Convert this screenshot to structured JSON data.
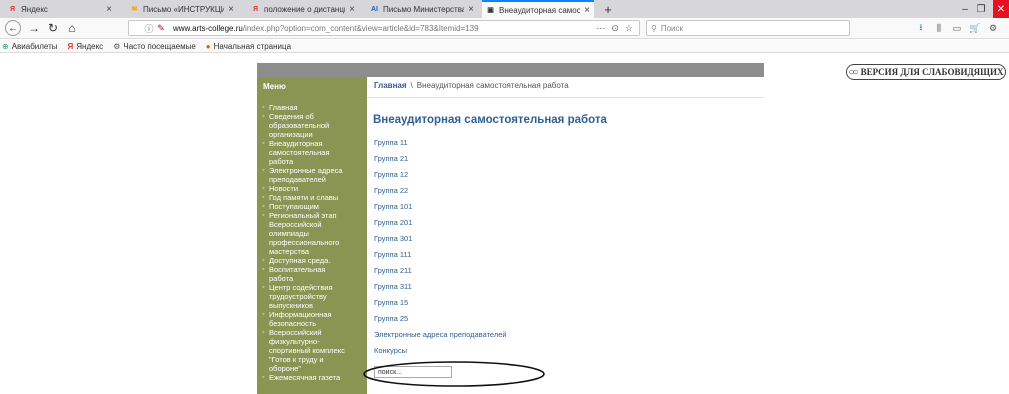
{
  "browser": {
    "tabs": [
      {
        "label": "Яндекс",
        "favicon": "Я",
        "favicon_color": "#d33",
        "active": false
      },
      {
        "label": "Письмо «ИНСТРУКЦИЯ ПО С",
        "favicon": "✉",
        "favicon_color": "#e8a300",
        "active": false
      },
      {
        "label": "положение о дистанционно",
        "favicon": "Я",
        "favicon_color": "#d33",
        "active": false
      },
      {
        "label": "Письмо Министерства прос",
        "favicon": "AI",
        "favicon_color": "#2a5db0",
        "active": false
      },
      {
        "label": "Внеаудиторная самостояте",
        "favicon": "▣",
        "favicon_color": "#333",
        "active": true
      }
    ],
    "new_tab": "+",
    "window_controls": {
      "minimize": "–",
      "restore": "❐",
      "close": "✕"
    },
    "nav": {
      "back": "←",
      "forward": "→",
      "reload": "↻",
      "home": "⌂"
    },
    "url": {
      "domain": "www.arts-college.ru",
      "path": "/index.php?option=com_content&view=article&id=783&Itemid=139"
    },
    "url_actions": {
      "more": "···",
      "pocket": "⊙",
      "bookmark": "☆"
    },
    "search": {
      "placeholder": "Поиск"
    },
    "toolbar_icons": [
      "⭳",
      "⫼",
      "▭",
      "🛒",
      "⚙"
    ]
  },
  "bookmarks": [
    {
      "label": "Авиабилеты",
      "icon": "⊕"
    },
    {
      "label": "Яндекс",
      "icon": "Я"
    },
    {
      "label": "Часто посещаемые",
      "icon": "⚙"
    },
    {
      "label": "Начальная страница",
      "icon": "●"
    }
  ],
  "site": {
    "impaired_version": "ВЕРСИЯ ДЛЯ СЛАБОВИДЯЩИХ",
    "sidebar": {
      "title": "Меню",
      "items": [
        "Главная",
        "Сведения об",
        "образовательной",
        "организации",
        "Внеаудиторная",
        "самостоятельная",
        "работа",
        "Электронные адреса",
        "преподавателей",
        "Новости",
        "Год памяти и славы",
        "Поступающим",
        "Региональный этап",
        "Всероссийской",
        "олимпиады",
        "профессионального",
        "мастерства",
        "Доступная среда.",
        "Воспитательная",
        "работа",
        "Центр содействия",
        "трудоустройству",
        "выпускников",
        "Информационная",
        "безопасность",
        "Всероссийский",
        "физкультурно-",
        "спортивный комплекс",
        "\"Готов к труду и",
        "обороне\"",
        "Ежемесячная газета"
      ],
      "bullet_rows": [
        0,
        1,
        4,
        7,
        9,
        10,
        11,
        12,
        17,
        18,
        20,
        23,
        25,
        30
      ]
    },
    "breadcrumb": {
      "home": "Главная",
      "separator": "\\",
      "current": "Внеаудиторная самостоятельная работа"
    },
    "title": "Внеаудиторная самостоятельная работа",
    "links": [
      "Группа 11",
      "Группа 21",
      "Группа 12",
      "Группа 22",
      "Группа 101",
      "Группа 201",
      "Группа 301",
      "Группа 111",
      "Группа 211",
      "Группа 311",
      "Группа 15",
      "Группа 25",
      "Электронные адреса преподавателей",
      "Конкурсы"
    ],
    "search_value": "поиск..."
  },
  "colors": {
    "sidebar": "#8a9554",
    "header_bar": "#8d8d8d",
    "link": "#2f5f93",
    "accent_tab": "#0a84ff"
  }
}
